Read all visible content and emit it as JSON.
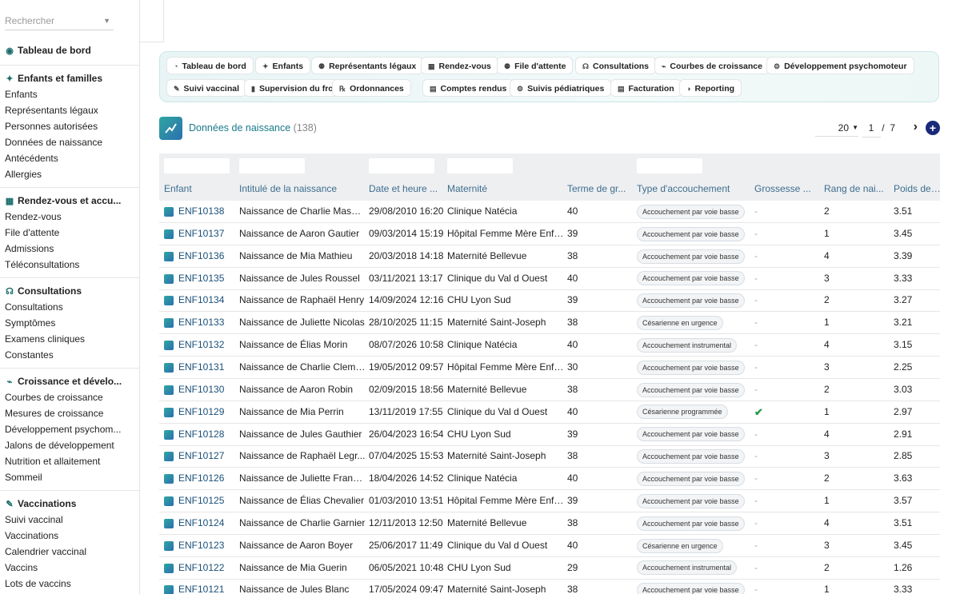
{
  "sidebar": {
    "search_placeholder": "Rechercher",
    "dashboard": "Tableau de bord",
    "sections": [
      {
        "title": "Enfants et familles",
        "items": [
          "Enfants",
          "Représentants légaux",
          "Personnes autorisées",
          "Données de naissance",
          "Antécédents",
          "Allergies"
        ]
      },
      {
        "title": "Rendez-vous et accu...",
        "items": [
          "Rendez-vous",
          "File d'attente",
          "Admissions",
          "Téléconsultations"
        ]
      },
      {
        "title": "Consultations",
        "items": [
          "Consultations",
          "Symptômes",
          "Examens cliniques",
          "Constantes"
        ]
      },
      {
        "title": "Croissance et dévelo...",
        "items": [
          "Courbes de croissance",
          "Mesures de croissance",
          "Développement psychom...",
          "Jalons de développement",
          "Nutrition et allaitement",
          "Sommeil"
        ]
      },
      {
        "title": "Vaccinations",
        "items": [
          "Suivi vaccinal",
          "Vaccinations",
          "Calendrier vaccinal",
          "Vaccins",
          "Lots de vaccins"
        ]
      }
    ]
  },
  "modules": [
    [
      "Tableau de bord",
      "Enfants",
      "Représentants légaux",
      "Rendez-vous",
      "File d'attente",
      "Consultations",
      "Courbes de croissance",
      "Développement psychomoteur"
    ],
    [
      "Suivi vaccinal",
      "Supervision du froid",
      "Ordonnances",
      "Comptes rendus",
      "Suivis pédiatriques",
      "Facturation",
      "Reporting"
    ]
  ],
  "page": {
    "title": "Données de naissance",
    "count": "(138)"
  },
  "pager": {
    "page_size": "20",
    "page": "1",
    "of": "/",
    "total": "7"
  },
  "table": {
    "columns": [
      "Enfant",
      "Intitulé de la naissance",
      "Date et heure ...",
      "Maternité",
      "Terme de gr...",
      "Type d'accouchement",
      "Grossesse ...",
      "Rang de nai...",
      "Poids de na"
    ],
    "rows": [
      [
        "ENF10138",
        "Naissance de Charlie Masson",
        "29/08/2010 16:20",
        "Clinique Natécia",
        "40",
        "Accouchement par voie basse",
        "-",
        "2",
        "3.51"
      ],
      [
        "ENF10137",
        "Naissance de Aaron Gautier",
        "09/03/2014 15:19",
        "Hôpital Femme Mère Enfant",
        "39",
        "Accouchement par voie basse",
        "-",
        "1",
        "3.45"
      ],
      [
        "ENF10136",
        "Naissance de Mia Mathieu",
        "20/03/2018 14:18",
        "Maternité Bellevue",
        "38",
        "Accouchement par voie basse",
        "-",
        "4",
        "3.39"
      ],
      [
        "ENF10135",
        "Naissance de Jules Roussel",
        "03/11/2021 13:17",
        "Clinique du Val d Ouest",
        "40",
        "Accouchement par voie basse",
        "-",
        "3",
        "3.33"
      ],
      [
        "ENF10134",
        "Naissance de Raphaël Henry",
        "14/09/2024 12:16",
        "CHU Lyon Sud",
        "39",
        "Accouchement par voie basse",
        "-",
        "2",
        "3.27"
      ],
      [
        "ENF10133",
        "Naissance de Juliette Nicolas",
        "28/10/2025 11:15",
        "Maternité Saint-Joseph",
        "38",
        "Césarienne en urgence",
        "-",
        "1",
        "3.21"
      ],
      [
        "ENF10132",
        "Naissance de Élias Morin",
        "08/07/2026 10:58",
        "Clinique Natécia",
        "40",
        "Accouchement instrumental",
        "-",
        "4",
        "3.15"
      ],
      [
        "ENF10131",
        "Naissance de Charlie Clement",
        "19/05/2012 09:57",
        "Hôpital Femme Mère Enfant",
        "30",
        "Accouchement par voie basse",
        "-",
        "3",
        "2.25"
      ],
      [
        "ENF10130",
        "Naissance de Aaron Robin",
        "02/09/2015 18:56",
        "Maternité Bellevue",
        "38",
        "Accouchement par voie basse",
        "-",
        "2",
        "3.03"
      ],
      [
        "ENF10129",
        "Naissance de Mia Perrin",
        "13/11/2019 17:55",
        "Clinique du Val d Ouest",
        "40",
        "Césarienne programmée",
        "check",
        "1",
        "2.97"
      ],
      [
        "ENF10128",
        "Naissance de Jules Gauthier",
        "26/04/2023 16:54",
        "CHU Lyon Sud",
        "39",
        "Accouchement par voie basse",
        "-",
        "4",
        "2.91"
      ],
      [
        "ENF10127",
        "Naissance de Raphaël Legr...",
        "07/04/2025 15:53",
        "Maternité Saint-Joseph",
        "38",
        "Accouchement par voie basse",
        "-",
        "3",
        "2.85"
      ],
      [
        "ENF10126",
        "Naissance de Juliette Franc...",
        "18/04/2026 14:52",
        "Clinique Natécia",
        "40",
        "Accouchement par voie basse",
        "-",
        "2",
        "3.63"
      ],
      [
        "ENF10125",
        "Naissance de Élias Chevalier",
        "01/03/2010 13:51",
        "Hôpital Femme Mère Enfant",
        "39",
        "Accouchement par voie basse",
        "-",
        "1",
        "3.57"
      ],
      [
        "ENF10124",
        "Naissance de Charlie Garnier",
        "12/11/2013 12:50",
        "Maternité Bellevue",
        "38",
        "Accouchement par voie basse",
        "-",
        "4",
        "3.51"
      ],
      [
        "ENF10123",
        "Naissance de Aaron Boyer",
        "25/06/2017 11:49",
        "Clinique du Val d Ouest",
        "40",
        "Césarienne en urgence",
        "-",
        "3",
        "3.45"
      ],
      [
        "ENF10122",
        "Naissance de Mia Guerin",
        "06/05/2021 10:48",
        "CHU Lyon Sud",
        "29",
        "Accouchement instrumental",
        "-",
        "2",
        "1.26"
      ],
      [
        "ENF10121",
        "Naissance de Jules Blanc",
        "17/05/2024 09:47",
        "Maternité Saint-Joseph",
        "38",
        "Accouchement par voie basse",
        "-",
        "1",
        "3.33"
      ]
    ]
  }
}
